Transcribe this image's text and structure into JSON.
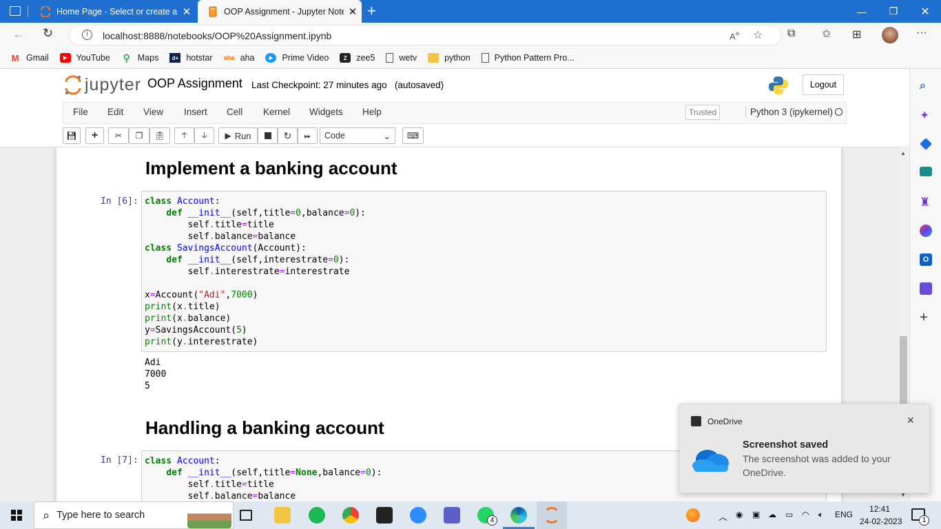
{
  "browser": {
    "tabs": [
      {
        "title": "Home Page - Select or create a n",
        "close": "✕"
      },
      {
        "title": "OOP Assignment - Jupyter Notel",
        "close": "✕"
      }
    ],
    "new_tab": "+",
    "url": "localhost:8888/notebooks/OOP%20Assignment.ipynb",
    "bookmarks": [
      "Gmail",
      "YouTube",
      "Maps",
      "hotstar",
      "aha",
      "Prime Video",
      "zee5",
      "wetv",
      "python",
      "Python Pattern Pro..."
    ]
  },
  "jupyter": {
    "logo_text": "jupyter",
    "notebook_name": "OOP Assignment",
    "checkpoint": "Last Checkpoint: 27 minutes ago",
    "autosaved": "(autosaved)",
    "logout": "Logout",
    "menu": [
      "File",
      "Edit",
      "View",
      "Insert",
      "Cell",
      "Kernel",
      "Widgets",
      "Help"
    ],
    "trusted": "Trusted",
    "kernel": "Python 3 (ipykernel)",
    "run_label": "Run",
    "cell_type": "Code"
  },
  "cells": {
    "heading1": "Implement a banking account",
    "prompt1": "In [6]:",
    "output1": [
      "Adi",
      "7000",
      "5"
    ],
    "heading2": "Handling a banking account",
    "prompt2": "In [7]:"
  },
  "toast": {
    "app": "OneDrive",
    "title": "Screenshot saved",
    "body_line1": "The screenshot was added to your",
    "body_line2": "OneDrive."
  },
  "taskbar": {
    "search_placeholder": "Type here to search",
    "teams_badge": "4",
    "language": "ENG",
    "time": "12:41",
    "date": "24-02-2023",
    "notification_count": "1"
  },
  "colors": {
    "titlebar": "#1f6fd0",
    "prompt": "#303f9f",
    "keyword": "#008000",
    "class_name": "#0000ff",
    "string": "#ba2121",
    "operator": "#aa22ff"
  }
}
